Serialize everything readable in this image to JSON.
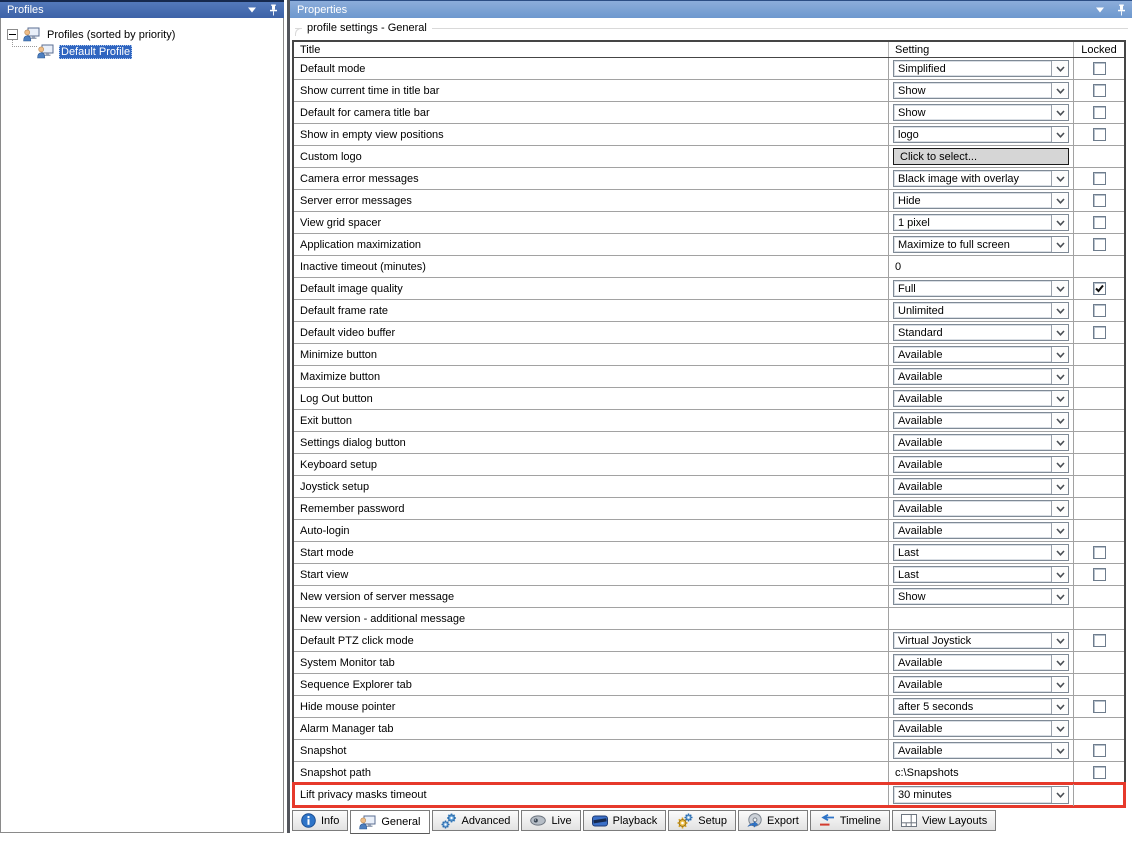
{
  "left_panel": {
    "title": "Profiles",
    "tree": {
      "root_label": "Profiles (sorted by priority)",
      "child_label": "Default Profile"
    }
  },
  "right_panel": {
    "title": "Properties",
    "group_label": "profile settings - General",
    "highlight_color": "#e6392b",
    "table": {
      "columns": [
        "Title",
        "Setting",
        "Locked"
      ],
      "rows": [
        {
          "title": "Default mode",
          "setting": "Simplified",
          "control": "dropdown",
          "locked": "unchecked",
          "highlighted": false
        },
        {
          "title": "Show current time in title bar",
          "setting": "Show",
          "control": "dropdown",
          "locked": "unchecked",
          "highlighted": false
        },
        {
          "title": "Default for camera title bar",
          "setting": "Show",
          "control": "dropdown",
          "locked": "unchecked",
          "highlighted": false
        },
        {
          "title": "Show in empty view positions",
          "setting": "logo",
          "control": "dropdown",
          "locked": "unchecked",
          "highlighted": false
        },
        {
          "title": "Custom logo",
          "setting": "Click to select...",
          "control": "button",
          "locked": "none",
          "highlighted": false
        },
        {
          "title": "Camera error messages",
          "setting": "Black image with overlay",
          "control": "dropdown",
          "locked": "unchecked",
          "highlighted": false
        },
        {
          "title": "Server error messages",
          "setting": "Hide",
          "control": "dropdown",
          "locked": "unchecked",
          "highlighted": false
        },
        {
          "title": "View grid spacer",
          "setting": "1 pixel",
          "control": "dropdown",
          "locked": "unchecked",
          "highlighted": false
        },
        {
          "title": "Application maximization",
          "setting": "Maximize to full screen",
          "control": "dropdown",
          "locked": "unchecked",
          "highlighted": false
        },
        {
          "title": "Inactive timeout (minutes)",
          "setting": "0",
          "control": "text",
          "locked": "none",
          "highlighted": false
        },
        {
          "title": "Default image quality",
          "setting": "Full",
          "control": "dropdown",
          "locked": "checked",
          "highlighted": false
        },
        {
          "title": "Default frame rate",
          "setting": "Unlimited",
          "control": "dropdown",
          "locked": "unchecked",
          "highlighted": false
        },
        {
          "title": "Default video buffer",
          "setting": "Standard",
          "control": "dropdown",
          "locked": "unchecked",
          "highlighted": false
        },
        {
          "title": "Minimize button",
          "setting": "Available",
          "control": "dropdown",
          "locked": "none",
          "highlighted": false
        },
        {
          "title": "Maximize button",
          "setting": "Available",
          "control": "dropdown",
          "locked": "none",
          "highlighted": false
        },
        {
          "title": "Log Out button",
          "setting": "Available",
          "control": "dropdown",
          "locked": "none",
          "highlighted": false
        },
        {
          "title": "Exit button",
          "setting": "Available",
          "control": "dropdown",
          "locked": "none",
          "highlighted": false
        },
        {
          "title": "Settings dialog button",
          "setting": "Available",
          "control": "dropdown",
          "locked": "none",
          "highlighted": false
        },
        {
          "title": "Keyboard setup",
          "setting": "Available",
          "control": "dropdown",
          "locked": "none",
          "highlighted": false
        },
        {
          "title": "Joystick setup",
          "setting": "Available",
          "control": "dropdown",
          "locked": "none",
          "highlighted": false
        },
        {
          "title": "Remember password",
          "setting": "Available",
          "control": "dropdown",
          "locked": "none",
          "highlighted": false
        },
        {
          "title": "Auto-login",
          "setting": "Available",
          "control": "dropdown",
          "locked": "none",
          "highlighted": false
        },
        {
          "title": "Start mode",
          "setting": "Last",
          "control": "dropdown",
          "locked": "unchecked",
          "highlighted": false
        },
        {
          "title": "Start view",
          "setting": "Last",
          "control": "dropdown",
          "locked": "unchecked",
          "highlighted": false
        },
        {
          "title": "New version of server message",
          "setting": "Show",
          "control": "dropdown",
          "locked": "none",
          "highlighted": false
        },
        {
          "title": "New version - additional message",
          "setting": "",
          "control": "none",
          "locked": "none",
          "highlighted": false
        },
        {
          "title": "Default PTZ click mode",
          "setting": "Virtual Joystick",
          "control": "dropdown",
          "locked": "unchecked",
          "highlighted": false
        },
        {
          "title": "System Monitor tab",
          "setting": "Available",
          "control": "dropdown",
          "locked": "none",
          "highlighted": false
        },
        {
          "title": "Sequence Explorer tab",
          "setting": "Available",
          "control": "dropdown",
          "locked": "none",
          "highlighted": false
        },
        {
          "title": "Hide mouse pointer",
          "setting": "after 5 seconds",
          "control": "dropdown",
          "locked": "unchecked",
          "highlighted": false
        },
        {
          "title": "Alarm Manager tab",
          "setting": "Available",
          "control": "dropdown",
          "locked": "none",
          "highlighted": false
        },
        {
          "title": "Snapshot",
          "setting": "Available",
          "control": "dropdown",
          "locked": "unchecked",
          "highlighted": false
        },
        {
          "title": "Snapshot path",
          "setting": "c:\\Snapshots",
          "control": "text",
          "locked": "unchecked",
          "highlighted": false
        },
        {
          "title": "Lift privacy masks timeout",
          "setting": "30 minutes",
          "control": "dropdown",
          "locked": "none",
          "highlighted": true
        }
      ]
    },
    "tabs": [
      {
        "label": "Info",
        "icon": "info-icon",
        "active": false
      },
      {
        "label": "General",
        "icon": "general-icon",
        "active": true
      },
      {
        "label": "Advanced",
        "icon": "advanced-icon",
        "active": false
      },
      {
        "label": "Live",
        "icon": "live-icon",
        "active": false
      },
      {
        "label": "Playback",
        "icon": "playback-icon",
        "active": false
      },
      {
        "label": "Setup",
        "icon": "setup-icon",
        "active": false
      },
      {
        "label": "Export",
        "icon": "export-icon",
        "active": false
      },
      {
        "label": "Timeline",
        "icon": "timeline-icon",
        "active": false
      },
      {
        "label": "View Layouts",
        "icon": "view-layouts-icon",
        "active": false
      }
    ]
  }
}
